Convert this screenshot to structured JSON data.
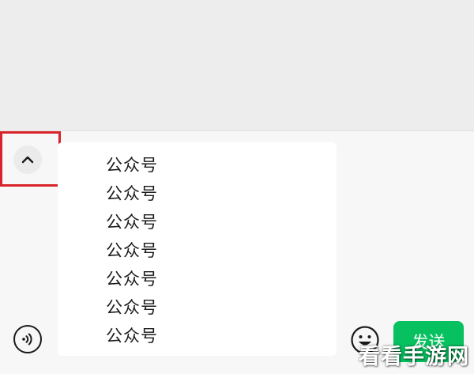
{
  "input": {
    "lines": [
      "公众号",
      "公众号",
      "公众号",
      "公众号",
      "公众号",
      "公众号",
      "公众号"
    ]
  },
  "toolbar": {
    "collapse_icon": "chevron-up-icon",
    "voice_icon": "voice-icon",
    "emoji_icon": "smiley-icon",
    "send_label": "发送"
  },
  "watermark": "看看手游网",
  "colors": {
    "send_button": "#07c160",
    "highlight": "#d9232a",
    "chat_background": "#ededed",
    "input_panel": "#f7f7f7"
  }
}
